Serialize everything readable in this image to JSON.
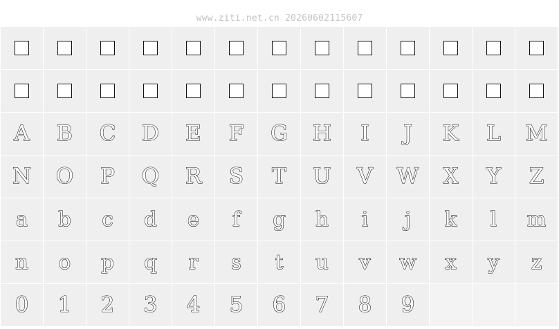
{
  "watermark": "www.ziti.net.cn 20260602115607",
  "rows": [
    {
      "type": "box",
      "glyphs": [
        "",
        "",
        "",
        "",
        "",
        "",
        "",
        "",
        "",
        "",
        "",
        "",
        ""
      ]
    },
    {
      "type": "box",
      "glyphs": [
        "",
        "",
        "",
        "",
        "",
        "",
        "",
        "",
        "",
        "",
        "",
        "",
        ""
      ]
    },
    {
      "type": "text",
      "glyphs": [
        "A",
        "B",
        "C",
        "D",
        "E",
        "F",
        "G",
        "H",
        "I",
        "J",
        "K",
        "L",
        "M"
      ]
    },
    {
      "type": "text",
      "glyphs": [
        "N",
        "O",
        "P",
        "Q",
        "R",
        "S",
        "T",
        "U",
        "V",
        "W",
        "X",
        "Y",
        "Z"
      ]
    },
    {
      "type": "text",
      "glyphs": [
        "a",
        "b",
        "c",
        "d",
        "e",
        "f",
        "g",
        "h",
        "i",
        "j",
        "k",
        "l",
        "m"
      ]
    },
    {
      "type": "text",
      "glyphs": [
        "n",
        "o",
        "p",
        "q",
        "r",
        "s",
        "t",
        "u",
        "v",
        "w",
        "x",
        "y",
        "z"
      ]
    },
    {
      "type": "text",
      "glyphs": [
        "0",
        "1",
        "2",
        "3",
        "4",
        "5",
        "6",
        "7",
        "8",
        "9",
        "",
        "",
        ""
      ]
    }
  ]
}
